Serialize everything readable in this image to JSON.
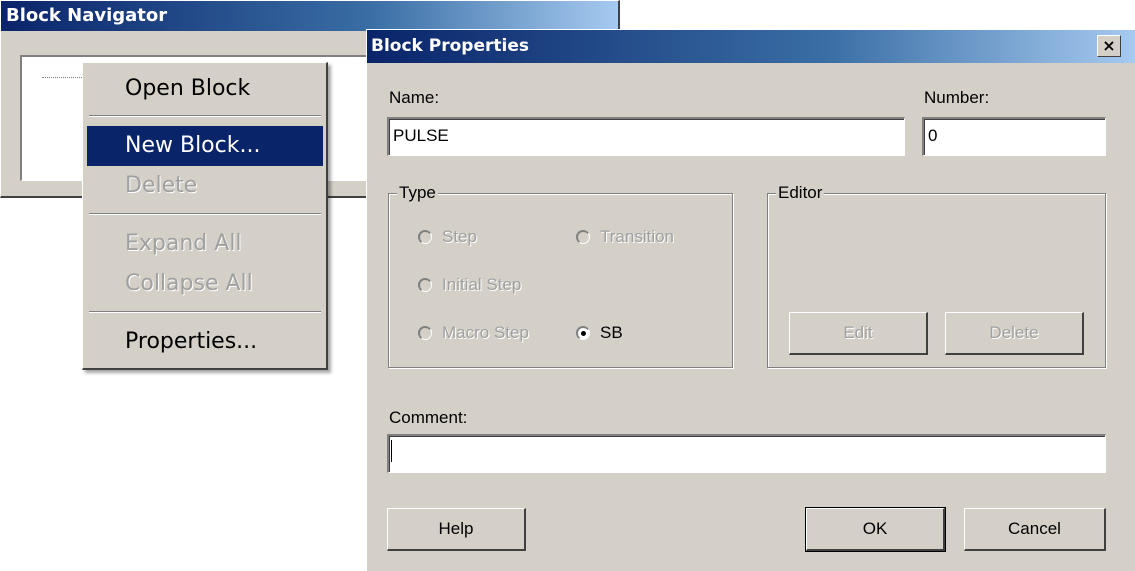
{
  "navigator": {
    "title": "Block Navigator"
  },
  "context_menu": {
    "items": [
      {
        "label": "Open Block",
        "state": "enabled"
      },
      {
        "label": "New Block...",
        "state": "selected"
      },
      {
        "label": "Delete",
        "state": "disabled"
      },
      {
        "label": "Expand All",
        "state": "disabled"
      },
      {
        "label": "Collapse All",
        "state": "disabled"
      },
      {
        "label": "Properties...",
        "state": "enabled"
      }
    ]
  },
  "dialog": {
    "title": "Block Properties",
    "close_label": "×",
    "name_label": "Name:",
    "name_value": "PULSE",
    "number_label": "Number:",
    "number_value": "0",
    "type_group": {
      "title": "Type",
      "options": [
        {
          "label": "Step",
          "checked": false,
          "disabled": true
        },
        {
          "label": "Transition",
          "checked": false,
          "disabled": true
        },
        {
          "label": "Initial Step",
          "checked": false,
          "disabled": true
        },
        {
          "label": "Macro Step",
          "checked": false,
          "disabled": true
        },
        {
          "label": "SB",
          "checked": true,
          "disabled": false
        }
      ]
    },
    "editor_group": {
      "title": "Editor",
      "edit_label": "Edit",
      "delete_label": "Delete"
    },
    "comment_label": "Comment:",
    "comment_value": "",
    "help_label": "Help",
    "ok_label": "OK",
    "cancel_label": "Cancel"
  },
  "colors": {
    "face": "#d4d0c8",
    "title_active": "#0a246a",
    "selection": "#0a246a",
    "disabled_text": "#a0a0a0"
  }
}
